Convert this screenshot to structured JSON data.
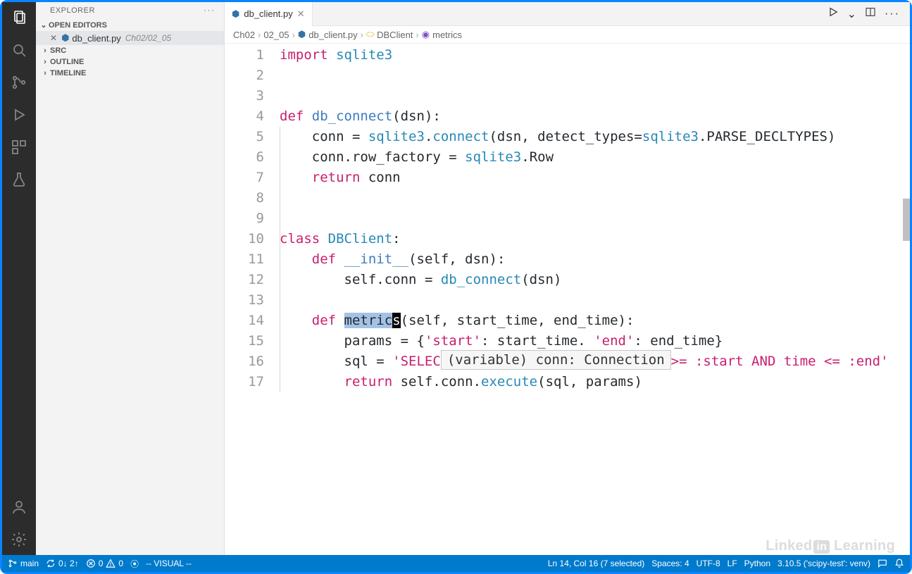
{
  "explorer": {
    "title": "EXPLORER",
    "open_editors": "OPEN EDITORS",
    "file_name": "db_client.py",
    "file_path": "Ch02/02_05",
    "sections": [
      "SRC",
      "OUTLINE",
      "TIMELINE"
    ]
  },
  "tab": {
    "name": "db_client.py"
  },
  "breadcrumbs": {
    "parts": [
      "Ch02",
      "02_05",
      "db_client.py",
      "DBClient",
      "metrics"
    ]
  },
  "hover": {
    "text": "(variable) conn: Connection"
  },
  "code": {
    "lines": [
      {
        "n": 1,
        "tokens": [
          [
            "kw",
            "import"
          ],
          [
            "sp",
            " "
          ],
          [
            "type",
            "sqlite3"
          ]
        ]
      },
      {
        "n": 2,
        "tokens": []
      },
      {
        "n": 3,
        "tokens": []
      },
      {
        "n": 4,
        "tokens": [
          [
            "kw",
            "def"
          ],
          [
            "sp",
            " "
          ],
          [
            "fn",
            "db_connect"
          ],
          [
            "op",
            "("
          ],
          [
            "id",
            "dsn"
          ],
          [
            "op",
            "):"
          ]
        ]
      },
      {
        "n": 5,
        "tokens": [
          [
            "sp",
            "    "
          ],
          [
            "id",
            "conn "
          ],
          [
            "op",
            "= "
          ],
          [
            "type",
            "sqlite3"
          ],
          [
            "op",
            "."
          ],
          [
            "call",
            "connect"
          ],
          [
            "op",
            "("
          ],
          [
            "id",
            "dsn"
          ],
          [
            "op",
            ", "
          ],
          [
            "id",
            "detect_types"
          ],
          [
            "op",
            "="
          ],
          [
            "type",
            "sqlite3"
          ],
          [
            "op",
            "."
          ],
          [
            "id",
            "PARSE_DECLTYPES"
          ],
          [
            "op",
            ")"
          ]
        ]
      },
      {
        "n": 6,
        "tokens": [
          [
            "sp",
            "    "
          ],
          [
            "id",
            "conn"
          ],
          [
            "op",
            "."
          ],
          [
            "id",
            "row_factory "
          ],
          [
            "op",
            "= "
          ],
          [
            "type",
            "sqlite3"
          ],
          [
            "op",
            "."
          ],
          [
            "id",
            "Row"
          ]
        ]
      },
      {
        "n": 7,
        "tokens": [
          [
            "sp",
            "    "
          ],
          [
            "kw",
            "return"
          ],
          [
            "sp",
            " "
          ],
          [
            "id",
            "conn"
          ]
        ]
      },
      {
        "n": 8,
        "tokens": []
      },
      {
        "n": 9,
        "tokens": []
      },
      {
        "n": 10,
        "tokens": [
          [
            "kw",
            "class"
          ],
          [
            "sp",
            " "
          ],
          [
            "type",
            "DBClient"
          ],
          [
            "op",
            ":"
          ]
        ]
      },
      {
        "n": 11,
        "tokens": [
          [
            "sp",
            "    "
          ],
          [
            "kw",
            "def"
          ],
          [
            "sp",
            " "
          ],
          [
            "fn",
            "__init__"
          ],
          [
            "op",
            "("
          ],
          [
            "id",
            "self"
          ],
          [
            "op",
            ", "
          ],
          [
            "id",
            "dsn"
          ],
          [
            "op",
            "):"
          ]
        ]
      },
      {
        "n": 12,
        "tokens": [
          [
            "sp",
            "        "
          ],
          [
            "id",
            "self"
          ],
          [
            "op",
            "."
          ],
          [
            "id",
            "conn "
          ],
          [
            "op",
            "= "
          ],
          [
            "call",
            "db_connect"
          ],
          [
            "op",
            "("
          ],
          [
            "id",
            "dsn"
          ],
          [
            "op",
            ")"
          ]
        ]
      },
      {
        "n": 13,
        "tokens": []
      },
      {
        "n": 14,
        "tokens": [
          [
            "sp",
            "    "
          ],
          [
            "kw",
            "def"
          ],
          [
            "sp",
            " "
          ],
          [
            "sel",
            "metric"
          ],
          [
            "cur",
            "s"
          ],
          [
            "op",
            "("
          ],
          [
            "id",
            "self"
          ],
          [
            "op",
            ", "
          ],
          [
            "id",
            "start_time"
          ],
          [
            "op",
            ", "
          ],
          [
            "id",
            "end_time"
          ],
          [
            "op",
            "):"
          ]
        ]
      },
      {
        "n": 15,
        "tokens": [
          [
            "sp",
            "        "
          ],
          [
            "id",
            "params "
          ],
          [
            "op",
            "= "
          ],
          [
            "op",
            "{"
          ],
          [
            "str",
            "'start'"
          ],
          [
            "op",
            ": "
          ],
          [
            "id",
            "start_time"
          ],
          [
            "op",
            ". "
          ],
          [
            "str",
            "'end'"
          ],
          [
            "op",
            ": "
          ],
          [
            "id",
            "end_time"
          ],
          [
            "op",
            "}"
          ]
        ]
      },
      {
        "n": 16,
        "tokens": [
          [
            "sp",
            "        "
          ],
          [
            "id",
            "sql "
          ],
          [
            "op",
            "= "
          ],
          [
            "str",
            "'SELEC"
          ],
          [
            "hover",
            ""
          ],
          [
            "str",
            ">= :start AND time <= :end'"
          ]
        ]
      },
      {
        "n": 17,
        "tokens": [
          [
            "sp",
            "        "
          ],
          [
            "kw",
            "return"
          ],
          [
            "sp",
            " "
          ],
          [
            "id",
            "self"
          ],
          [
            "op",
            "."
          ],
          [
            "id",
            "conn"
          ],
          [
            "op",
            "."
          ],
          [
            "call",
            "execute"
          ],
          [
            "op",
            "("
          ],
          [
            "id",
            "sql"
          ],
          [
            "op",
            ", "
          ],
          [
            "id",
            "params"
          ],
          [
            "op",
            ")"
          ]
        ]
      }
    ]
  },
  "status": {
    "branch": "main",
    "sync": "0↓ 2↑",
    "errors": "0",
    "warnings": "0",
    "mode": "-- VISUAL --",
    "pos": "Ln 14, Col 16 (7 selected)",
    "spaces": "Spaces: 4",
    "encoding": "UTF-8",
    "eol": "LF",
    "lang": "Python",
    "interpreter": "3.10.5 ('scipy-test': venv)"
  },
  "watermark": {
    "brand": "Linked",
    "in": "in",
    "tail": " Learning"
  }
}
